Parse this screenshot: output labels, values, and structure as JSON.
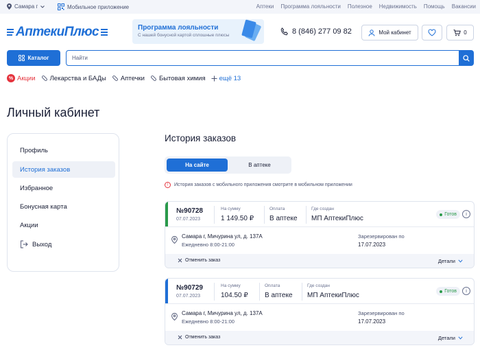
{
  "topbar": {
    "city": "Самара г",
    "mobile_app": "Мобильное приложение",
    "links": [
      "Аптеки",
      "Программа лояльности",
      "Полезное",
      "Недвижимость",
      "Помощь",
      "Вакансии"
    ]
  },
  "header": {
    "logo": "АптекиПлюс",
    "loyalty_title": "Программа лояльности",
    "loyalty_subtitle": "С нашей бонусной картой сплошные плюсы",
    "phone": "8 (846) 277 09 82",
    "cabinet_label": "Мой кабинет",
    "cart_count": "0"
  },
  "search": {
    "catalog_label": "Каталог",
    "placeholder": "Найти"
  },
  "categories": {
    "sale": "Акции",
    "sale_badge": "%",
    "items": [
      "Лекарства и БАДы",
      "Аптечки",
      "Бытовая химия"
    ],
    "more": "ещё 13"
  },
  "page": {
    "title": "Личный кабинет"
  },
  "sidebar": {
    "items": [
      "Профиль",
      "История заказов",
      "Избранное",
      "Бонусная карта",
      "Акции"
    ],
    "logout": "Выход"
  },
  "orders": {
    "title": "История заказов",
    "tab_site": "На сайте",
    "tab_pharmacy": "В аптеке",
    "note": "История заказов с мобильного приложения смотрите в мобильном приложении",
    "sum_label": "На сумму",
    "pay_label": "Оплата",
    "created_label": "Где создан",
    "reserved_label": "Зарезервирован по",
    "cancel_label": "Отменить заказ",
    "details_label": "Детали",
    "list": [
      {
        "number": "№90728",
        "date": "07.07.2023",
        "sum": "1 149.50 ₽",
        "payment": "В аптеке",
        "created": "МП АптекиПлюс",
        "status": "Готов",
        "address": "Самара г, Мичурина ул, д. 137А",
        "hours": "Ежедневно 8:00-21:00",
        "reserved_until": "17.07.2023",
        "accent": "#2a9a4a"
      },
      {
        "number": "№90729",
        "date": "07.07.2023",
        "sum": "104.50 ₽",
        "payment": "В аптеке",
        "created": "МП АптекиПлюс",
        "status": "Готов",
        "address": "Самара г, Мичурина ул, д. 137А",
        "hours": "Ежедневно 8:00-21:00",
        "reserved_until": "17.07.2023",
        "accent": "#1f6fd6"
      }
    ]
  },
  "colors": {
    "brand": "#1f6fd6",
    "sale": "#e5333d",
    "ready": "#2a9a4a"
  }
}
